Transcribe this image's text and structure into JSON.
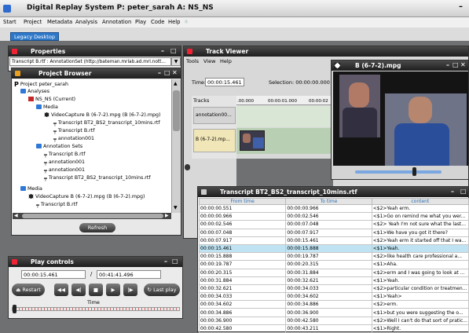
{
  "app": {
    "title": "Digital Replay System P: peter_sarah A: NS_NS",
    "menu": [
      "Start",
      "Project",
      "Metadata",
      "Analysis",
      "Annotation",
      "Play",
      "Code",
      "Help"
    ],
    "tab": "Legacy Desktop"
  },
  "properties": {
    "title": "Properties",
    "selector": "Transcript B.rtf : AnnotationSet (http://bateman.mrlab.ad.mrl.nott..."
  },
  "project_browser": {
    "title": "Project Browser",
    "tree": [
      {
        "label": "Project peter_sarah",
        "icon": "project-icon"
      },
      {
        "label": "Analyses",
        "icon": "folder-icon"
      },
      {
        "label": "NS_NS (Current)",
        "icon": "analysis-icon"
      },
      {
        "label": "Media",
        "icon": "folder-icon"
      },
      {
        "label": "VideoCapture B (6-7-2).mpg (B (6-7-2).mpg)",
        "icon": "film-icon"
      },
      {
        "label": "Transcript BT2_BS2_transcript_10mins.rtf",
        "icon": "transcript-icon"
      },
      {
        "label": "Transcript B.rtf",
        "icon": "transcript-icon"
      },
      {
        "label": "annotation001",
        "icon": "transcript-icon"
      },
      {
        "label": "Annotation Sets",
        "icon": "folder-icon"
      },
      {
        "label": "Transcript B.rtf",
        "icon": "transcript-icon"
      },
      {
        "label": "annotation001",
        "icon": "transcript-icon"
      },
      {
        "label": "annotation001",
        "icon": "transcript-icon"
      },
      {
        "label": "Transcript BT2_BS2_transcript_10mins.rtf",
        "icon": "transcript-icon"
      },
      {
        "label": "Media",
        "icon": "folder-icon"
      },
      {
        "label": "VideoCapture B (6-7-2).mpg (B (6-7-2).mpg)",
        "icon": "film-icon"
      },
      {
        "label": "Transcript B.rtf",
        "icon": "transcript-icon"
      }
    ],
    "refresh": "Refresh"
  },
  "track_viewer": {
    "title": "Track Viewer",
    "menu": [
      "Tools",
      "View",
      "Help"
    ],
    "time_label": "Time:",
    "time_value": "00:00:15.461",
    "selection_label": "Selection: 00:00:00.000 - 0",
    "tracks_label": "Tracks",
    "ruler": [
      ".00.000",
      "00:00:01.000",
      "00:00:02"
    ],
    "track_names": [
      "annotation00...",
      "B (6-7-2).mp..."
    ]
  },
  "video": {
    "title": "B (6-7-2).mpg",
    "progress": 0.68
  },
  "transcript": {
    "title": "Transcript BT2_BS2_transcript_10mins.rtf",
    "columns": [
      "From time",
      "To time",
      "content"
    ],
    "rows": [
      [
        "00:00:00.551",
        "00:00:00.966",
        "<$2>Yeah erm."
      ],
      [
        "00:00:00.966",
        "00:00:02.546",
        "<$1>Go on remind me what you wer..."
      ],
      [
        "00:00:02.546",
        "00:00:07.048",
        "<$2> Yeah I'm not sure what the last..."
      ],
      [
        "00:00:07.048",
        "00:00:07.917",
        "<$1>We have you got it there?"
      ],
      [
        "00:00:07.917",
        "00:00:15.461",
        "<$2>Yeah erm it started off that I wa..."
      ],
      [
        "00:00:15.461",
        "00:00:15.888",
        "<$1>Yeah."
      ],
      [
        "00:00:15.888",
        "00:00:19.787",
        "<$2>like health care professional a..."
      ],
      [
        "00:00:19.787",
        "00:00:20.315",
        "<$1>Aha."
      ],
      [
        "00:00:20.315",
        "00:00:31.884",
        "<$2>erm and I was going to look at ..."
      ],
      [
        "00:00:31.884",
        "00:00:32.621",
        "<$1>Yeah."
      ],
      [
        "00:00:32.621",
        "00:00:34.033",
        "<$2>particular condition or treatmen..."
      ],
      [
        "00:00:34.033",
        "00:00:34.602",
        "<$1>Yeah>"
      ],
      [
        "00:00:34.602",
        "00:00:34.886",
        "<$2>erm."
      ],
      [
        "00:00:34.886",
        "00:00:36.900",
        "<$1>but you were suggesting the o..."
      ],
      [
        "00:00:36.900",
        "00:00:42.580",
        "<$2>Well I can't do that sort of pratic..."
      ],
      [
        "00:00:42.580",
        "00:00:43.211",
        "<$1>Right."
      ]
    ],
    "selected_row": 5
  },
  "play_controls": {
    "title": "Play controls",
    "current": "00:00:15.461",
    "separator": "/",
    "total": "00:41:41.496",
    "restart": "Restart",
    "last_play": "Last play",
    "time_label": "Time"
  },
  "colors": {
    "titlebar": "#2a2a2a",
    "accent": "#2e78c9",
    "selected_row": "#bfe3f2"
  }
}
